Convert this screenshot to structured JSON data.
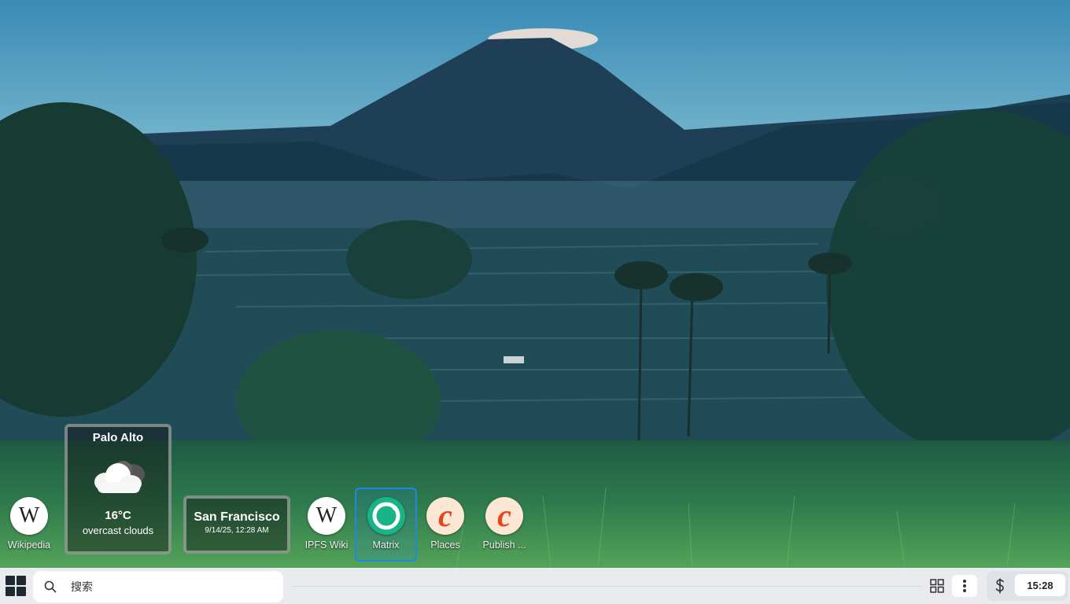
{
  "desktop": {
    "apps": [
      {
        "label": "Wikipedia",
        "icon": "wikipedia-icon"
      },
      {
        "label": "IPFS Wiki",
        "icon": "wikipedia-icon"
      },
      {
        "label": "Matrix",
        "icon": "matrix-icon"
      },
      {
        "label": "Places",
        "icon": "places-icon"
      },
      {
        "label": "Publish ...",
        "icon": "publish-icon"
      }
    ],
    "weather": {
      "city": "Palo Alto",
      "temperature": "16°C",
      "description": "overcast clouds",
      "icon": "cloud-icon"
    },
    "clock_widget": {
      "city": "San Francisco",
      "datetime": "9/14/25, 12:28 AM"
    }
  },
  "taskbar": {
    "start_icon": "grid-start-icon",
    "search_placeholder": "搜索",
    "time": "15:28",
    "accent": "#1e88e5"
  }
}
